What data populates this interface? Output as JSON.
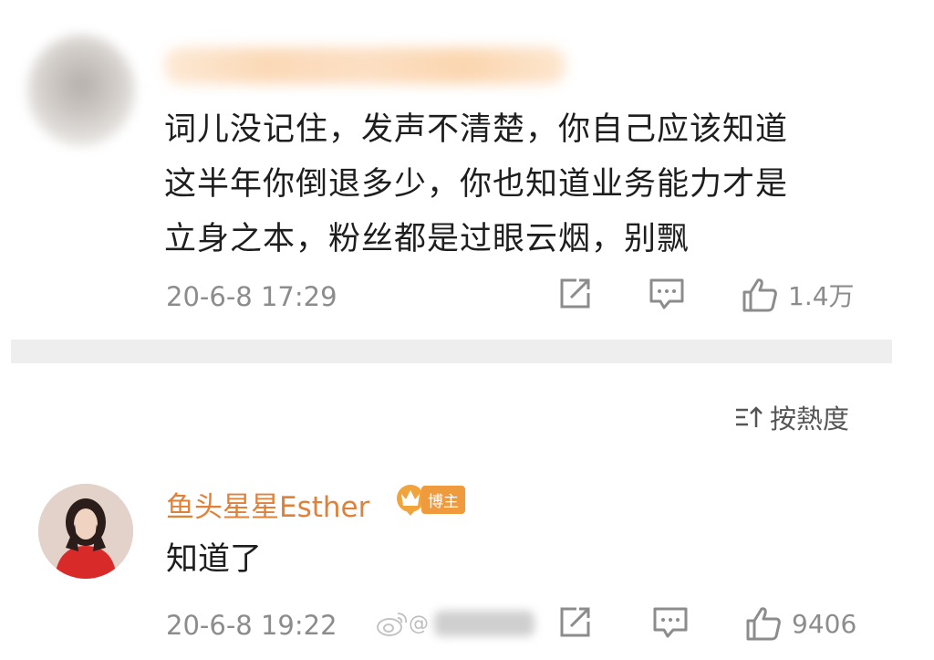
{
  "comment": {
    "text": "词儿没记住，发声不清楚，你自己应该知道这半年你倒退多少，你也知道业务能力才是立身之本，粉丝都是过眼云烟，别飘",
    "lines": [
      "词儿没记住，发声不清楚，你自己应该知道",
      "这半年你倒退多少，你也知道业务能力才是",
      "立身之本，粉丝都是过眼云烟，别飘"
    ],
    "timestamp": "20-6-8 17:29",
    "like_count": "1.4万"
  },
  "sort": {
    "label": "按熱度",
    "icon": "sort-icon"
  },
  "reply": {
    "author": "鱼头星星Esther",
    "badge": "博主",
    "text": "知道了",
    "timestamp": "20-6-8 19:22",
    "like_count": "9406"
  },
  "watermark": {
    "prefix": "@"
  },
  "colors": {
    "author": "#e0813a",
    "badge": "#ef9a3d",
    "meta": "#8c8c8c",
    "divider": "#eeeeee"
  },
  "icons": {
    "share": "share-icon",
    "comment": "comment-icon",
    "like": "thumbs-up-icon",
    "weibo": "weibo-logo-icon"
  }
}
